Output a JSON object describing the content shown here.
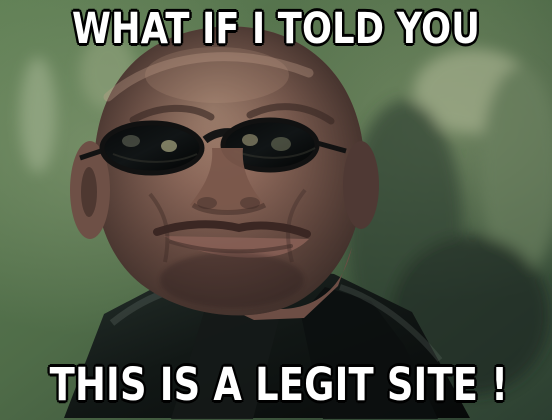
{
  "meme": {
    "top_text": "WHAT IF I TOLD YOU",
    "bottom_text": "THIS IS A LEGIT SITE !"
  }
}
